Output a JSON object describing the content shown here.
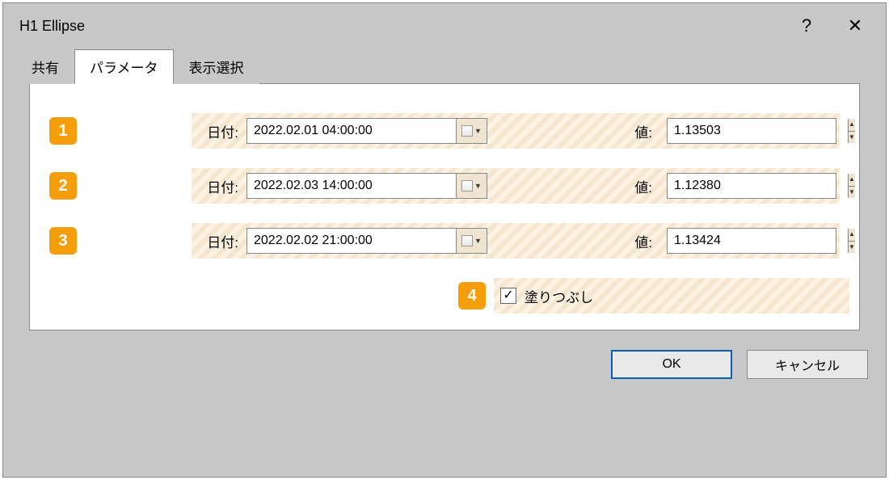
{
  "title": "H1 Ellipse",
  "titlebar": {
    "help": "?",
    "close": "✕"
  },
  "tabs": [
    {
      "label": "共有",
      "active": false
    },
    {
      "label": "パラメータ",
      "active": true
    },
    {
      "label": "表示選択",
      "active": false
    }
  ],
  "rows": [
    {
      "badge": "1",
      "date_label": "日付:",
      "date_value": "2022.02.01 04:00:00",
      "value_label": "値:",
      "value": "1.13503"
    },
    {
      "badge": "2",
      "date_label": "日付:",
      "date_value": "2022.02.03 14:00:00",
      "value_label": "値:",
      "value": "1.12380"
    },
    {
      "badge": "3",
      "date_label": "日付:",
      "date_value": "2022.02.02 21:00:00",
      "value_label": "値:",
      "value": "1.13424"
    }
  ],
  "fill": {
    "badge": "4",
    "checked": true,
    "label": "塗りつぶし"
  },
  "footer": {
    "ok": "OK",
    "cancel": "キャンセル"
  }
}
